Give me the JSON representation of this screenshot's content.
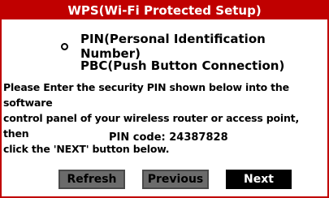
{
  "window": {
    "title": "WPS(Wi-Fi Protected Setup)"
  },
  "options": {
    "pin_label": "PIN(Personal Identification Number)",
    "pbc_label": "PBC(Push Button Connection)"
  },
  "instructions": {
    "line1": "Please Enter the security PIN shown below into the software",
    "line2": "control panel of your wireless router or access point, then",
    "line3": "click the 'NEXT' button below."
  },
  "pin": {
    "text": "PIN code: 24387828"
  },
  "buttons": {
    "refresh": "Refresh",
    "previous": "Previous",
    "next": "Next"
  },
  "colors": {
    "title_bg": "#c00000",
    "button_gray": "#6b6b6b",
    "button_dark": "#000000"
  }
}
